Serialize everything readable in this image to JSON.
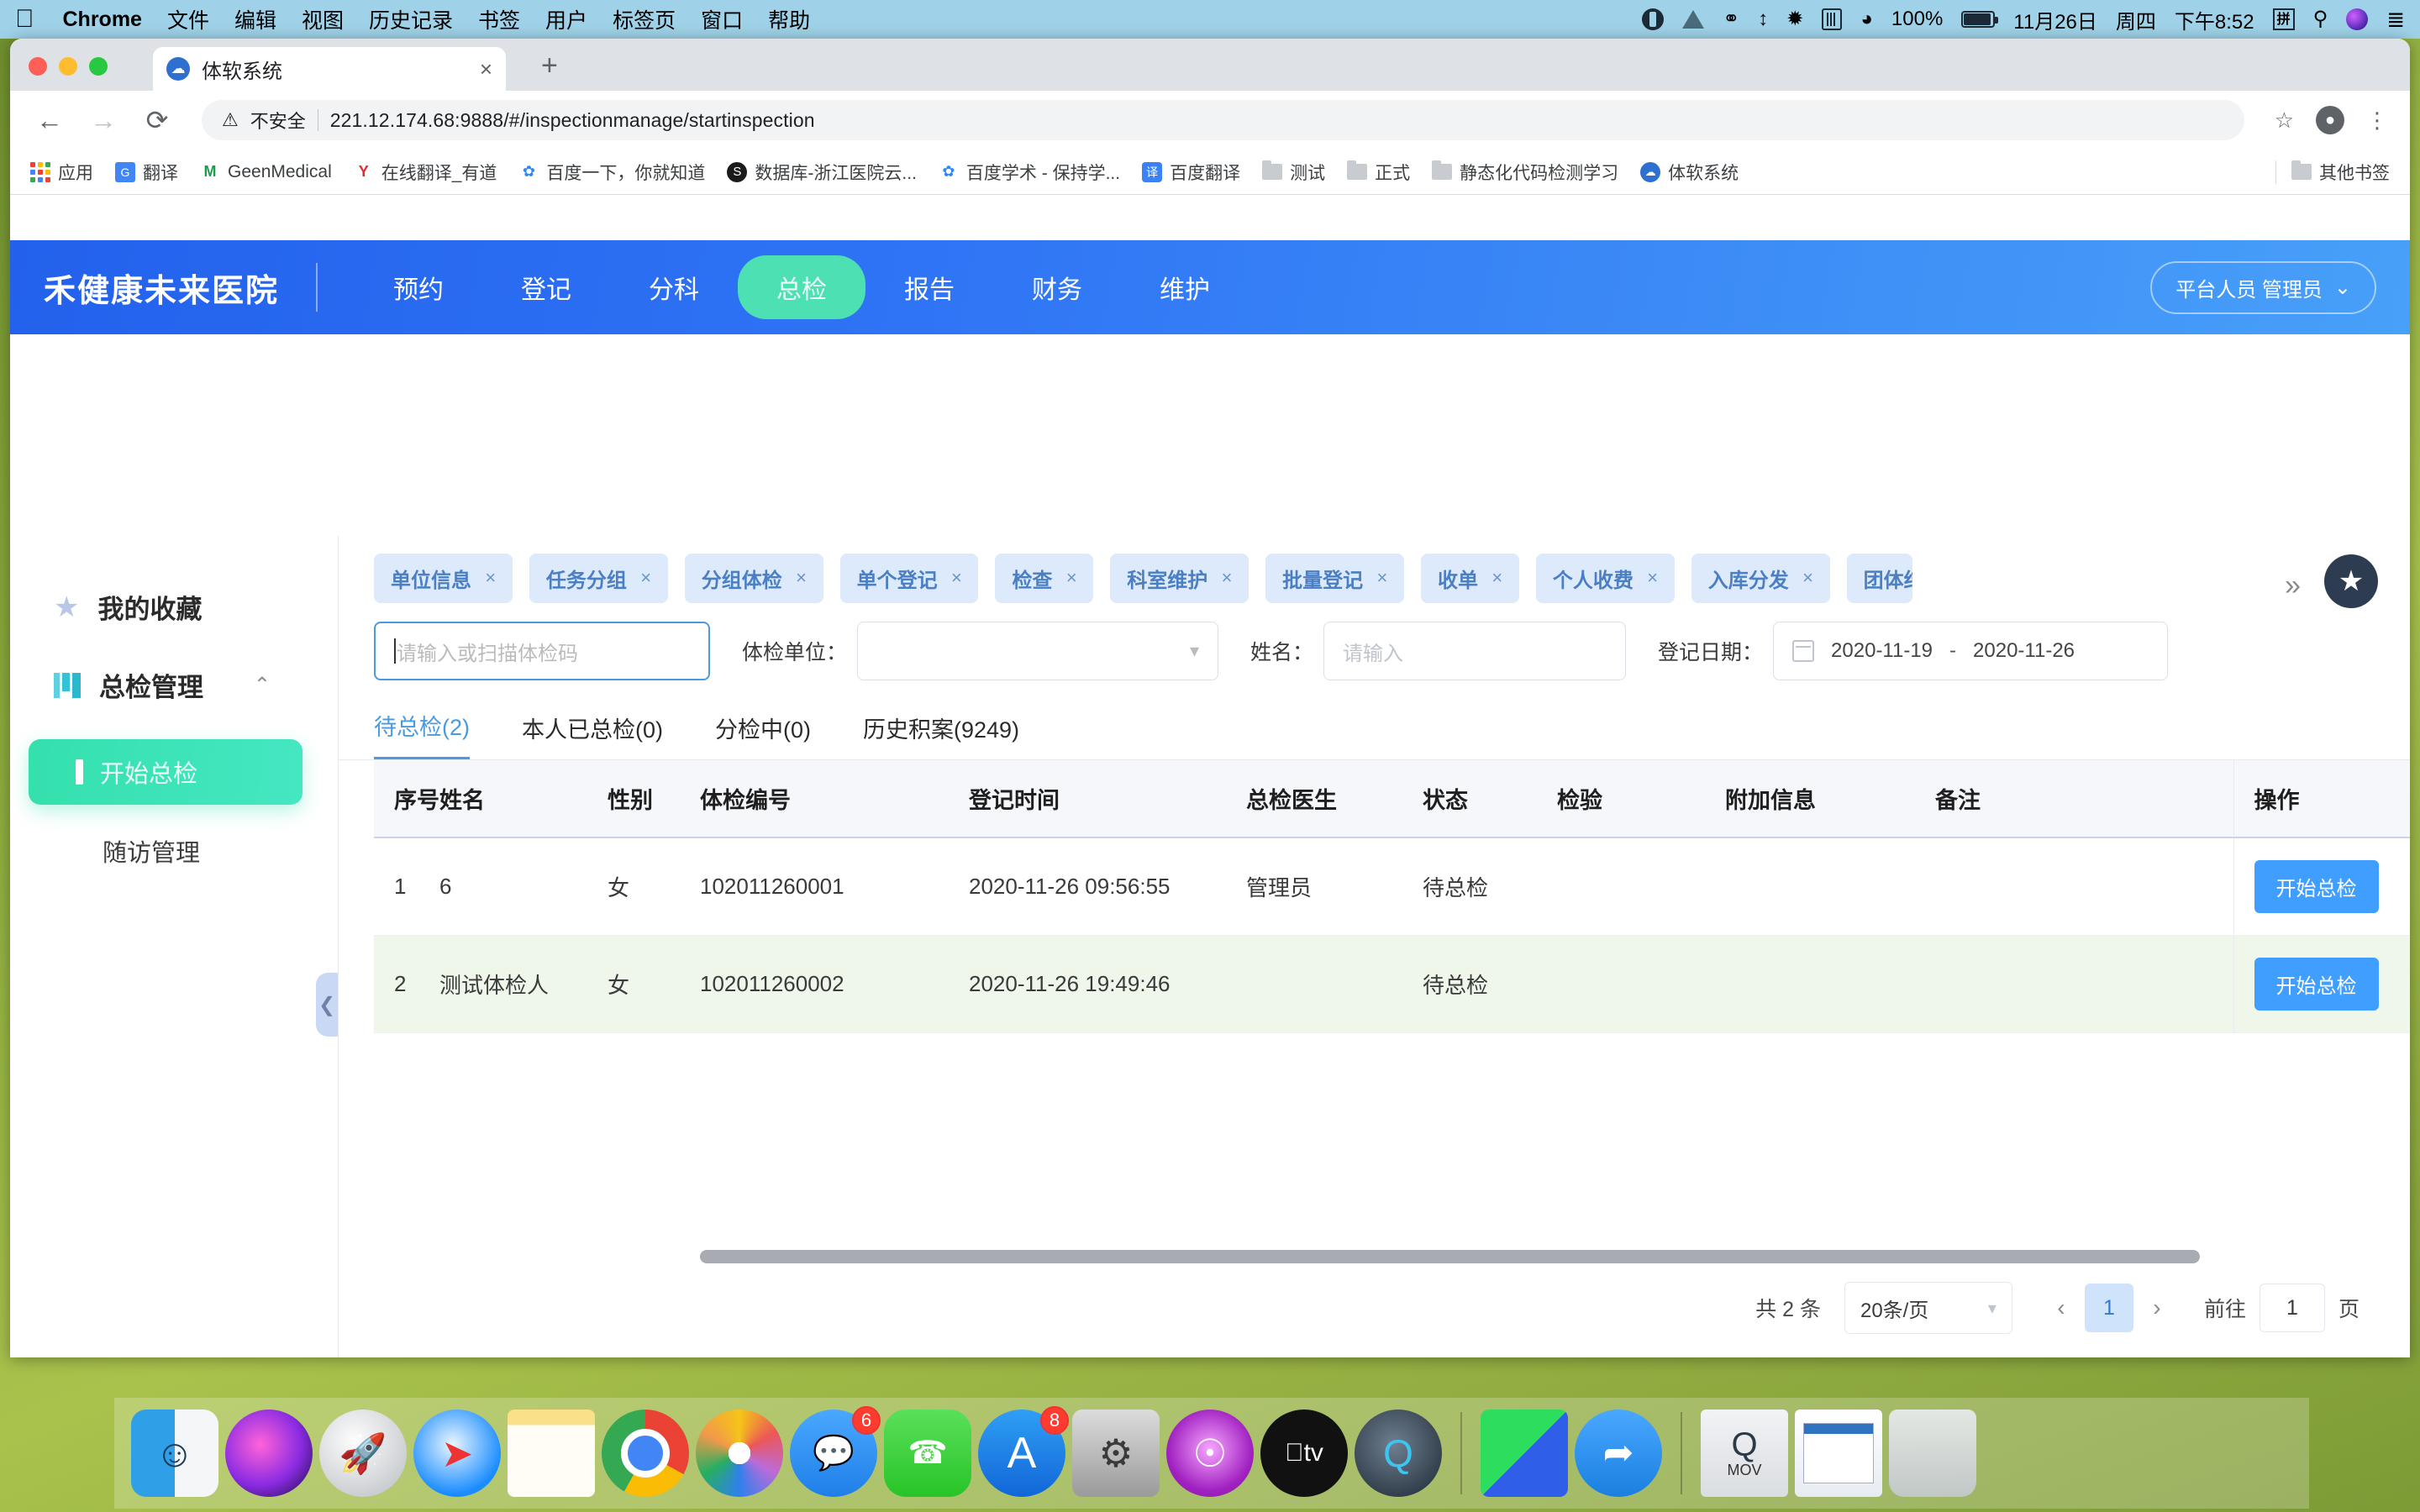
{
  "menubar": {
    "apple_icon": "apple-icon",
    "items": [
      "Chrome",
      "文件",
      "编辑",
      "视图",
      "历史记录",
      "书签",
      "用户",
      "标签页",
      "窗口",
      "帮助"
    ],
    "status": {
      "battery_percent": "100%",
      "date": "11月26日",
      "weekday": "周四",
      "time": "下午8:52",
      "input_method": "拼"
    }
  },
  "browser": {
    "tab": {
      "title": "体软系统",
      "favicon": "cloud-icon",
      "close": "×"
    },
    "newtab_label": "+",
    "nav": {
      "back": "←",
      "forward": "→",
      "reload": "⟳"
    },
    "omnibox": {
      "security_label": "不安全",
      "url": "221.12.174.68:9888/#/inspectionmanage/startinspection"
    },
    "bookmarks": [
      {
        "label": "应用",
        "icon": "apps-grid-icon"
      },
      {
        "label": "翻译",
        "icon": "google-translate-icon"
      },
      {
        "label": "GeenMedical",
        "icon": "geenmedical-icon"
      },
      {
        "label": "在线翻译_有道",
        "icon": "youdao-icon"
      },
      {
        "label": "百度一下，你就知道",
        "icon": "baidu-icon"
      },
      {
        "label": "数据库-浙江医院云...",
        "icon": "database-icon"
      },
      {
        "label": "百度学术 - 保持学...",
        "icon": "baidu-icon"
      },
      {
        "label": "百度翻译",
        "icon": "baidu-translate-icon"
      },
      {
        "label": "测试",
        "icon": "folder-icon"
      },
      {
        "label": "正式",
        "icon": "folder-icon"
      },
      {
        "label": "静态化代码检测学习",
        "icon": "folder-icon"
      },
      {
        "label": "体软系统",
        "icon": "cloud-icon"
      }
    ],
    "other_bookmarks": {
      "label": "其他书签",
      "icon": "folder-icon"
    }
  },
  "app": {
    "brand": "禾健康未来医院",
    "topnav": [
      {
        "label": "预约",
        "active": false
      },
      {
        "label": "登记",
        "active": false
      },
      {
        "label": "分科",
        "active": false
      },
      {
        "label": "总检",
        "active": true
      },
      {
        "label": "报告",
        "active": false
      },
      {
        "label": "财务",
        "active": false
      },
      {
        "label": "维护",
        "active": false
      }
    ],
    "user": {
      "label": "平台人员 管理员",
      "chevron": "⌄"
    }
  },
  "sidebar": {
    "favorites": {
      "label": "我的收藏",
      "icon": "star-icon"
    },
    "group": {
      "label": "总检管理",
      "icon": "book-icon",
      "chevron": "⌃"
    },
    "items": [
      {
        "label": "开始总检",
        "active": true
      },
      {
        "label": "随访管理",
        "active": false
      }
    ],
    "collapse_icon": "chevron-left-icon"
  },
  "main": {
    "chips": [
      "单位信息",
      "任务分组",
      "分组体检",
      "单个登记",
      "检查",
      "科室维护",
      "批量登记",
      "收单",
      "个人收费",
      "入库分发",
      "团体结"
    ],
    "chip_close": "×",
    "more_icon": "chevron-double-right-icon",
    "favorite_ball_icon": "star-icon",
    "filters": {
      "code_placeholder": "请输入或扫描体检码",
      "unit_label": "体检单位：",
      "unit_value": "",
      "name_label": "姓名：",
      "name_placeholder": "请输入",
      "date_label": "登记日期：",
      "date_start": "2020-11-19",
      "date_sep": "-",
      "date_end": "2020-11-26"
    },
    "tabs": [
      {
        "label": "待总检(2)",
        "active": true
      },
      {
        "label": "本人已总检(0)",
        "active": false
      },
      {
        "label": "分检中(0)",
        "active": false
      },
      {
        "label": "历史积案(9249)",
        "active": false
      }
    ],
    "table": {
      "headers": [
        "序号",
        "姓名",
        "性别",
        "体检编号",
        "登记时间",
        "总检医生",
        "状态",
        "检验",
        "附加信息",
        "备注",
        "操作"
      ],
      "rows": [
        {
          "seq": "1",
          "name": "6",
          "gender": "女",
          "code": "102011260001",
          "reg_time": "2020-11-26 09:56:55",
          "doctor": "管理员",
          "status": "待总检",
          "lab": "",
          "extra": "",
          "remark": "",
          "action": "开始总检",
          "highlight": false
        },
        {
          "seq": "2",
          "name": "测试体检人",
          "gender": "女",
          "code": "102011260002",
          "reg_time": "2020-11-26 19:49:46",
          "doctor": "",
          "status": "待总检",
          "lab": "",
          "extra": "",
          "remark": "",
          "action": "开始总检",
          "highlight": true
        }
      ]
    },
    "pagination": {
      "total": "共 2 条",
      "page_size": "20条/页",
      "prev": "‹",
      "current_page": "1",
      "next": "›",
      "goto_label": "前往",
      "goto_value": "1",
      "page_unit": "页"
    }
  },
  "dock": {
    "items": [
      {
        "name": "finder",
        "badge": ""
      },
      {
        "name": "siri",
        "badge": ""
      },
      {
        "name": "launchpad",
        "badge": ""
      },
      {
        "name": "safari",
        "badge": ""
      },
      {
        "name": "notes",
        "badge": ""
      },
      {
        "name": "chrome",
        "badge": ""
      },
      {
        "name": "photos",
        "badge": ""
      },
      {
        "name": "messages",
        "badge": "6"
      },
      {
        "name": "facetime",
        "badge": ""
      },
      {
        "name": "app-store",
        "badge": "8"
      },
      {
        "name": "system-preferences",
        "badge": ""
      },
      {
        "name": "podcasts",
        "badge": ""
      },
      {
        "name": "apple-tv",
        "badge": ""
      },
      {
        "name": "quicktime",
        "badge": ""
      },
      {
        "name": "app-green-blue",
        "badge": ""
      },
      {
        "name": "wing-app",
        "badge": ""
      },
      {
        "name": "mov-file",
        "badge": ""
      },
      {
        "name": "spreadsheet-file",
        "badge": ""
      },
      {
        "name": "trash",
        "badge": ""
      }
    ],
    "mov_label": "MOV"
  },
  "colors": {
    "brand_blue": "#2f74f5",
    "accent_green": "#34e0ad",
    "primary_button": "#409eff",
    "chip_bg": "#ddeafb",
    "row_highlight": "#eef7ea"
  }
}
